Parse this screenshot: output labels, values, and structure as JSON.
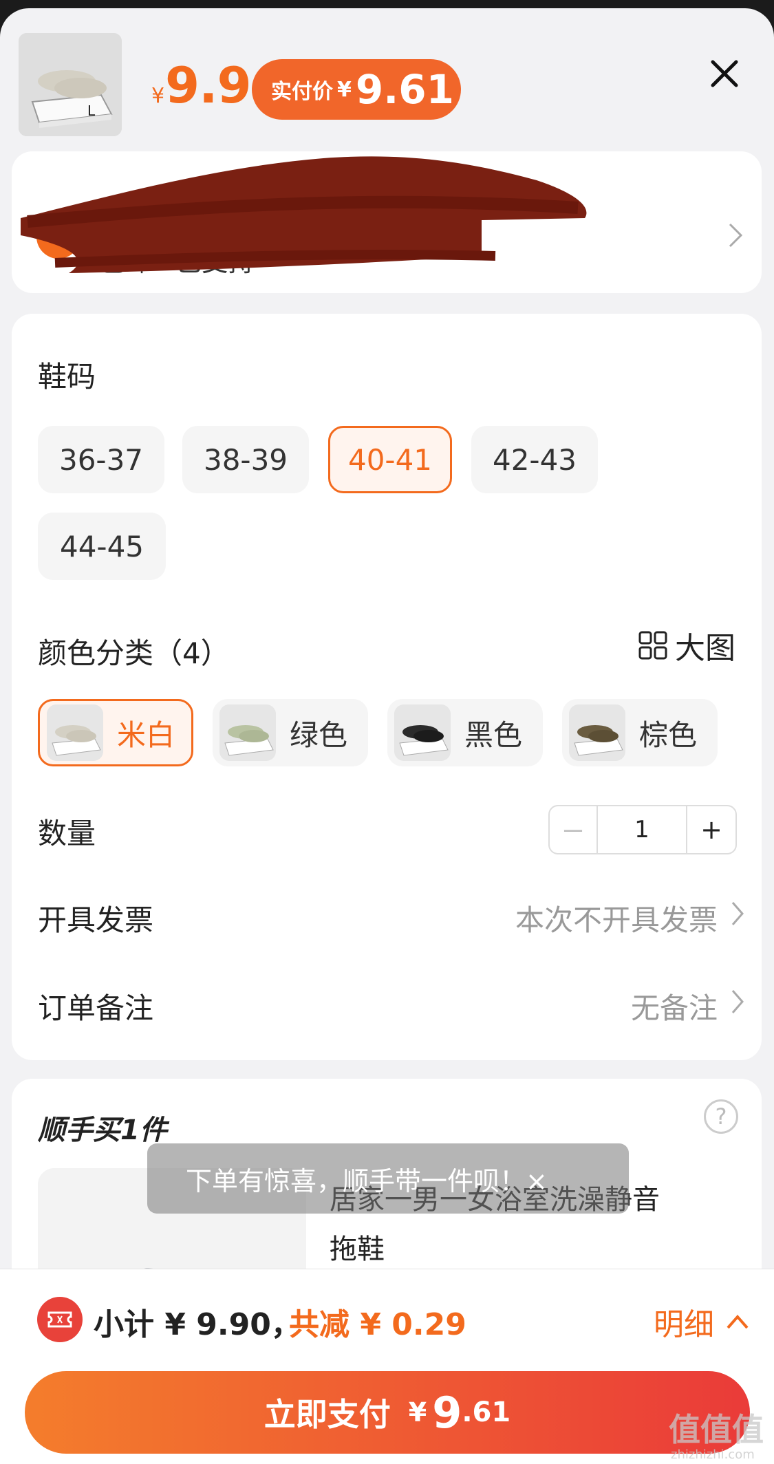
{
  "header": {
    "currency_small": "¥",
    "price": "9.9",
    "pay_label": "实付价",
    "pay_currency": "¥",
    "pay_price": "9.61"
  },
  "address": {
    "line1": "",
    "line2": "包邮 · 已支持"
  },
  "size": {
    "title": "鞋码",
    "options": [
      "36-37",
      "38-39",
      "40-41",
      "42-43",
      "44-45"
    ],
    "selected": "40-41"
  },
  "color": {
    "title": "颜色分类（4）",
    "big_pic_label": "大图",
    "options": [
      "米白",
      "绿色",
      "黑色",
      "棕色"
    ],
    "selected": "米白"
  },
  "quantity": {
    "label": "数量",
    "minus": "－",
    "value": "1",
    "plus": "+"
  },
  "invoice": {
    "label": "开具发票",
    "value": "本次不开具发票"
  },
  "remark": {
    "label": "订单备注",
    "value": "无备注"
  },
  "addon": {
    "title": "顺手买1件",
    "help": "?",
    "product_name": "居家一男一女浴室洗澡静音拖鞋",
    "toast": "下单有惊喜，顺手带一件呗！×"
  },
  "footer": {
    "subtotal": "小计 ¥ 9.90，",
    "discount": "共减 ¥ 0.29",
    "detail": "明细",
    "pay_label": "立即支付",
    "pay_currency": "¥",
    "pay_int": "9",
    "pay_dec": ".61"
  },
  "watermark": {
    "main": "值值值",
    "sub": "zhizhizhi.com"
  },
  "colors": {
    "accent": "#f36a1d",
    "pay_gradient_start": "#f47d2c",
    "pay_gradient_end": "#ea3b39",
    "redaction": "#7a2012"
  }
}
